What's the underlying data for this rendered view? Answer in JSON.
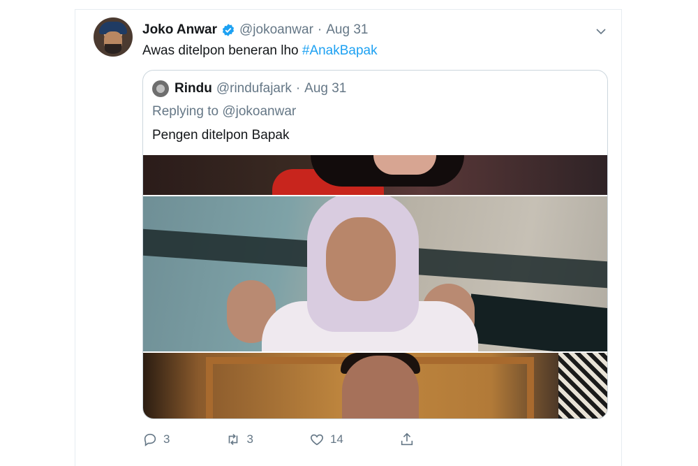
{
  "tweet": {
    "author_name": "Joko Anwar",
    "author_handle": "@jokoanwar",
    "separator": "·",
    "date": "Aug 31",
    "text_prefix": "Awas ditelpon beneran lho ",
    "hashtag": "#AnakBapak"
  },
  "quoted_tweet": {
    "author_name": "Rindu",
    "author_handle": "@rindufajark",
    "separator": "·",
    "date": "Aug 31",
    "replying_prefix": "Replying to ",
    "replying_to": "@jokoanwar",
    "text": "Pengen ditelpon Bapak"
  },
  "actions": {
    "reply_count": "3",
    "retweet_count": "3",
    "like_count": "14"
  },
  "icons": [
    "verified-icon",
    "chevron-down-icon",
    "reply-icon",
    "retweet-icon",
    "like-icon",
    "share-icon"
  ],
  "colors": {
    "link": "#1da1f2",
    "secondary_text": "#657786",
    "border": "#ccd6dd",
    "verified": "#1da1f2"
  }
}
